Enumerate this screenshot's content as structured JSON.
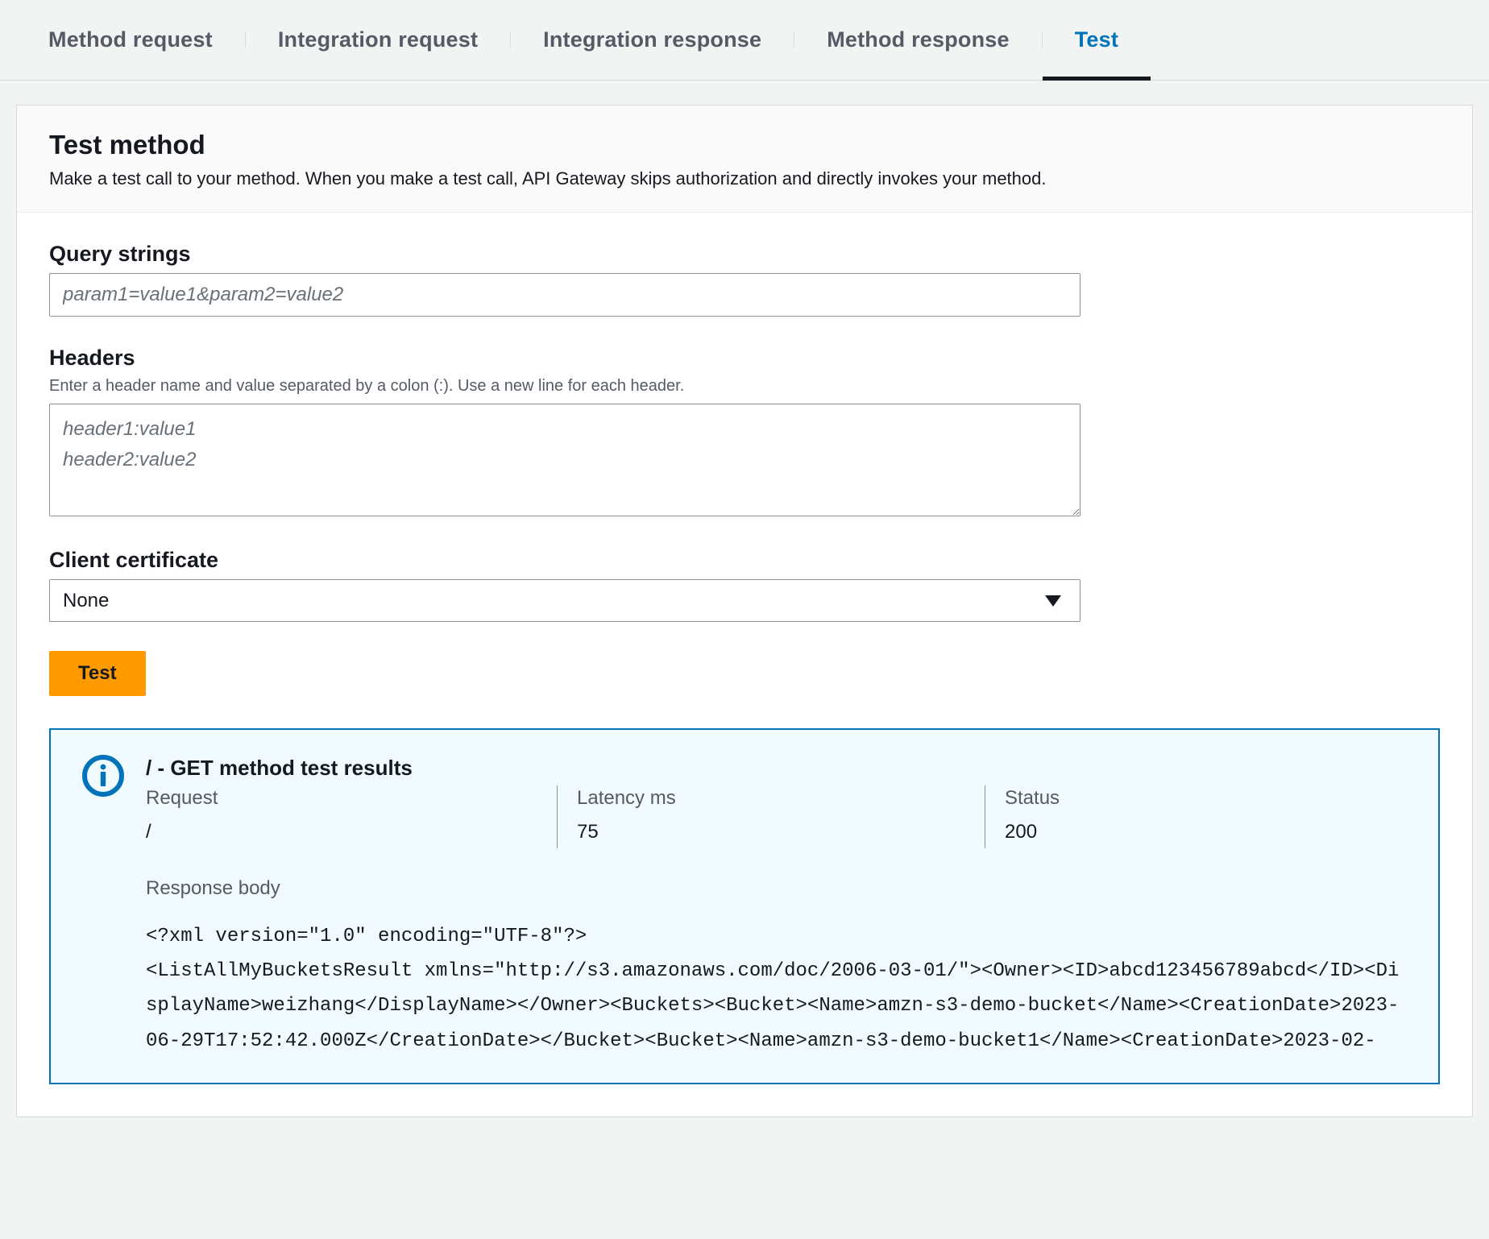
{
  "tabs": [
    {
      "label": "Method request",
      "active": false
    },
    {
      "label": "Integration request",
      "active": false
    },
    {
      "label": "Integration response",
      "active": false
    },
    {
      "label": "Method response",
      "active": false
    },
    {
      "label": "Test",
      "active": true
    }
  ],
  "panel": {
    "title": "Test method",
    "description": "Make a test call to your method. When you make a test call, API Gateway skips authorization and directly invokes your method."
  },
  "form": {
    "query_strings": {
      "label": "Query strings",
      "placeholder": "param1=value1&param2=value2",
      "value": ""
    },
    "headers": {
      "label": "Headers",
      "help": "Enter a header name and value separated by a colon (:). Use a new line for each header.",
      "placeholder": "header1:value1\nheader2:value2",
      "value": ""
    },
    "client_certificate": {
      "label": "Client certificate",
      "selected": "None"
    },
    "test_button": "Test"
  },
  "results": {
    "title": "/ - GET method test results",
    "request_label": "Request",
    "request_value": "/",
    "latency_label": "Latency ms",
    "latency_value": "75",
    "status_label": "Status",
    "status_value": "200",
    "response_body_label": "Response body",
    "response_body": "<?xml version=\"1.0\" encoding=\"UTF-8\"?>\n<ListAllMyBucketsResult xmlns=\"http://s3.amazonaws.com/doc/2006-03-01/\"><Owner><ID>abcd123456789abcd</ID><DisplayName>weizhang</DisplayName></Owner><Buckets><Bucket><Name>amzn-s3-demo-bucket</Name><CreationDate>2023-06-29T17:52:42.000Z</CreationDate></Bucket><Bucket><Name>amzn-s3-demo-bucket1</Name><CreationDate>2023-02-"
  }
}
